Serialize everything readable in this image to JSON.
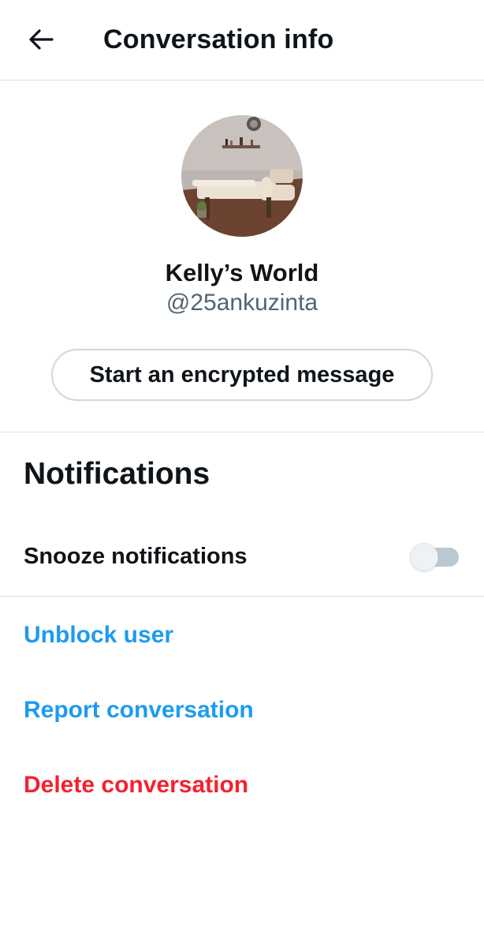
{
  "header": {
    "title": "Conversation info",
    "back_icon": "arrow-left-icon"
  },
  "profile": {
    "display_name": "Kelly’s World",
    "handle": "@25ankuzinta",
    "avatar_icon": "avatar-photo-massage-room",
    "encrypted_button_label": "Start an encrypted message"
  },
  "notifications": {
    "section_title": "Notifications",
    "snooze_label": "Snooze notifications",
    "snooze_on": false
  },
  "actions": {
    "unblock_label": "Unblock user",
    "report_label": "Report conversation",
    "delete_label": "Delete conversation"
  },
  "colors": {
    "link_blue": "#1d9bf0",
    "danger_red": "#f4212e",
    "secondary_text": "#536471",
    "divider": "#dcdfe3"
  }
}
